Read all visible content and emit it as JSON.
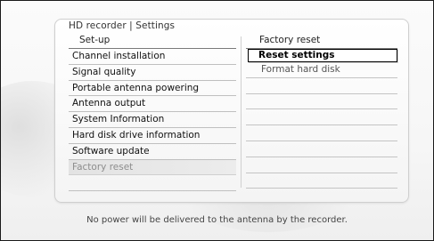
{
  "title": "HD recorder | Settings",
  "left_header": "Set-up",
  "right_header": "Factory reset",
  "menu": [
    {
      "label": "Channel installation"
    },
    {
      "label": "Signal quality"
    },
    {
      "label": "Portable antenna powering"
    },
    {
      "label": "Antenna output"
    },
    {
      "label": "System Information"
    },
    {
      "label": "Hard disk drive information"
    },
    {
      "label": "Software update"
    },
    {
      "label": "Factory reset"
    }
  ],
  "submenu": [
    {
      "label": "Reset settings"
    },
    {
      "label": "Format hard disk"
    }
  ],
  "status_text": "No power will be delivered to the antenna by the recorder."
}
